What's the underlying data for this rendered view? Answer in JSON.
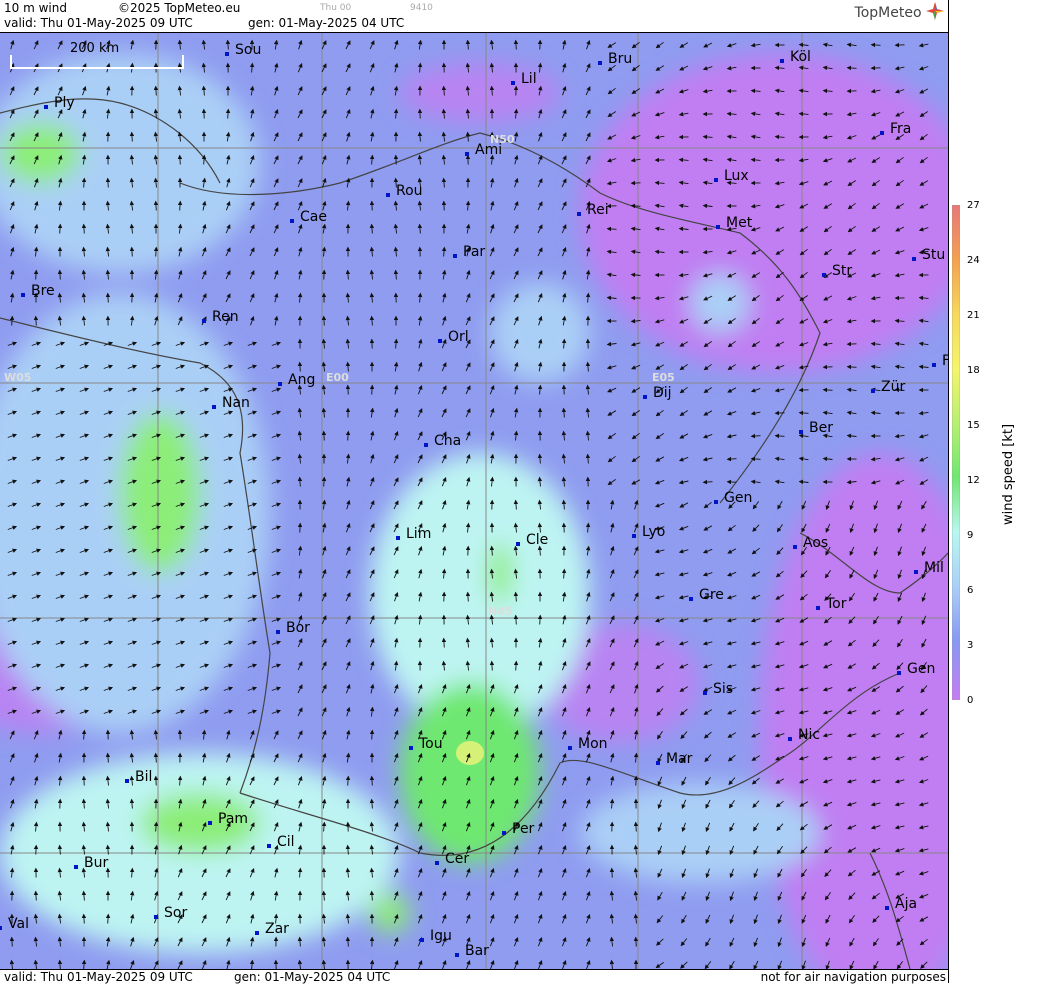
{
  "header": {
    "product": "10 m wind",
    "copyright": "©2025 TopMeteo.eu",
    "thu_small": "Thu 00",
    "code_small": "9410",
    "valid": "valid:  Thu  01-May-2025  09 UTC",
    "gen": "gen:  01-May-2025  04 UTC",
    "logo": "TopMeteo"
  },
  "footer": {
    "valid": "valid:  Thu  01-May-2025  09 UTC",
    "gen": "gen:  01-May-2025  04 UTC",
    "notice": "not for air navigation purposes"
  },
  "scale": {
    "label": "200 km"
  },
  "grid_labels": {
    "n50": "N50",
    "n45": "N45",
    "e00": "E00",
    "e05": "E05",
    "w05": "W05"
  },
  "cities": [
    "Sou",
    "Ply",
    "Lil",
    "Bru",
    "Köl",
    "Ami",
    "Fra",
    "Rou",
    "Lux",
    "Cae",
    "Rei",
    "Met",
    "Par",
    "Stu",
    "Bre",
    "Str",
    "Ren",
    "Orl",
    "F",
    "Ang",
    "Dij",
    "Zür",
    "Nan",
    "Ber",
    "Cha",
    "Gen",
    "Lim",
    "Cle",
    "Lyo",
    "Aos",
    "Mil",
    "Gre",
    "Tor",
    "Bor",
    "Gen",
    "Sis",
    "Tou",
    "Mon",
    "Nic",
    "Mar",
    "Bil",
    "Pam",
    "Cil",
    "Per",
    "Bur",
    "Cer",
    "Aja",
    "Sor",
    "Val",
    "Zar",
    "Igu",
    "Bar"
  ],
  "legend": {
    "title": "wind speed [kt]",
    "ticks": [
      "27",
      "24",
      "21",
      "18",
      "15",
      "12",
      "9",
      "6",
      "3",
      "0"
    ],
    "colors": [
      "#e87878",
      "#f4a050",
      "#f7d85a",
      "#f5f56a",
      "#b8f070",
      "#6ee870",
      "#b8f7f0",
      "#aad0f8",
      "#8899f2",
      "#c67cf2"
    ]
  }
}
